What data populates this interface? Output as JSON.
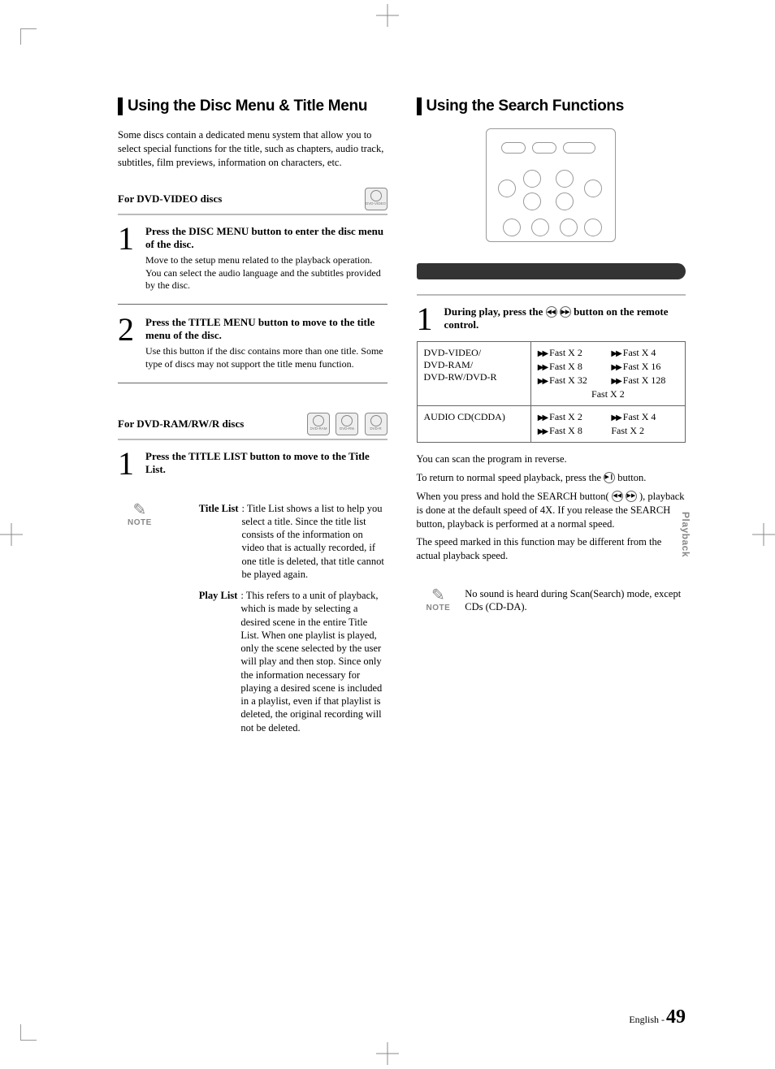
{
  "left": {
    "title": "Using the Disc Menu & Title Menu",
    "intro": "Some discs contain a dedicated menu system that allow you to select special functions for the title, such as chapters, audio track, subtitles, film previews, information on characters, etc.",
    "sub1": "For DVD-VIDEO discs",
    "badge1": "DVD-VIDEO",
    "step1_instr": "Press the DISC MENU button to enter the disc menu of the disc.",
    "step1_desc": "Move to the setup menu related to the playback operation.\nYou can select the audio language and the subtitles provided by the disc.",
    "step2_instr": "Press the TITLE MENU button to move to the title menu of the disc.",
    "step2_desc": "Use this button if the disc contains more than one title. Some type of discs may not support the title menu function.",
    "sub2": "For DVD-RAM/RW/R discs",
    "badge2a": "DVD-RAM",
    "badge2b": "DVD-RW",
    "badge2c": "DVD-R",
    "step2b_instr": "Press the TITLE LIST button to move to the Title List.",
    "note_title_term": "Title List",
    "note_title_list": ": Title List shows a list to help you select a title. Since the title list consists of the information on video that is actually recorded, if one title is deleted, that title cannot be played again.",
    "note_play_term": "Play List",
    "note_play_list": ": This refers to a unit of playback, which is made by selecting a desired scene in the entire Title List. When one playlist is played, only the scene selected by the user will play and then stop. Since only the information necessary for playing a desired scene is included in a playlist, even if that playlist is deleted, the original recording will not be deleted."
  },
  "right": {
    "title": "Using the Search Functions",
    "step1_instr_pre": "During play, press the ",
    "step1_instr_post": " button on the remote control.",
    "table": {
      "r1c1": "DVD-VIDEO/\nDVD-RAM/\nDVD-RW/DVD-R",
      "r1_speeds": [
        "Fast X 2",
        "Fast X 4",
        "Fast X 8",
        "Fast X 16",
        "Fast X 32",
        "Fast X 128"
      ],
      "r1_tail": "Fast X 2",
      "r2c1": "AUDIO CD(CDDA)",
      "r2_speeds": [
        "Fast X 2",
        "Fast X 4",
        "Fast X 8"
      ],
      "r2_tail": "Fast X 2"
    },
    "desc1": "You can scan the program in reverse.",
    "desc2_pre": "To return to normal speed playback, press the ",
    "desc2_post": " button.",
    "desc3_pre": "When you press and hold the SEARCH button( ",
    "desc3_post": " ), playback is done at the default speed of 4X. If you release the SEARCH button, playback is performed at a normal speed.",
    "desc4": "The speed marked in this function may be different from the actual playback speed.",
    "note": "No sound is heard during Scan(Search) mode, except CDs (CD-DA)."
  },
  "note_label": "NOTE",
  "sidetab": "Playback",
  "footer_lang": "English -",
  "footer_page": "49"
}
